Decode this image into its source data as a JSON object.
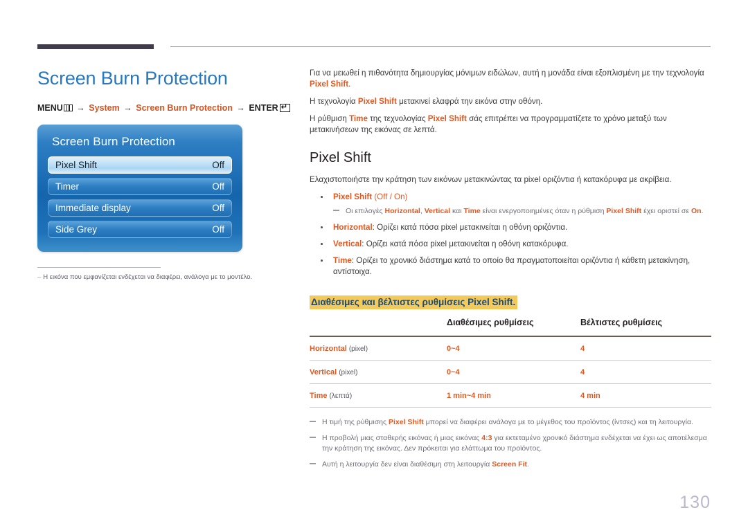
{
  "page": {
    "number": "130"
  },
  "left": {
    "title": "Screen Burn Protection",
    "breadcrumb": {
      "menu_label": "MENU",
      "menu_icon": "menu-bars-icon",
      "arrow": "→",
      "item1": "System",
      "item2": "Screen Burn Protection",
      "enter_label": "ENTER",
      "enter_icon": "enter-return-icon",
      "enter_glyph": "↵"
    },
    "osd": {
      "title": "Screen Burn Protection",
      "rows": [
        {
          "label": "Pixel Shift",
          "value": "Off",
          "selected": true
        },
        {
          "label": "Timer",
          "value": "Off",
          "selected": false
        },
        {
          "label": "Immediate display",
          "value": "Off",
          "selected": false
        },
        {
          "label": "Side Grey",
          "value": "Off",
          "selected": false
        }
      ]
    },
    "footnote": {
      "dash": "–",
      "text": "Η εικόνα που εμφανίζεται ενδέχεται να διαφέρει, ανάλογα με το μοντέλο."
    }
  },
  "right": {
    "intro": {
      "p1_a": "Για να μειωθεί η πιθανότητα δημιουργίας μόνιμων ειδώλων, αυτή η μονάδα είναι εξοπλισμένη με την τεχνολογία ",
      "p1_b": "Pixel Shift",
      "p1_c": ".",
      "p2_a": "Η τεχνολογία ",
      "p2_b": "Pixel Shift",
      "p2_c": " μετακινεί ελαφρά την εικόνα στην οθόνη.",
      "p3_a": "Η ρύθμιση ",
      "p3_b": "Time",
      "p3_c": " της τεχνολογίας ",
      "p3_d": "Pixel Shift",
      "p3_e": " σάς επιτρέπει να προγραμματίζετε το χρόνο μεταξύ των μετακινήσεων της εικόνας σε λεπτά."
    },
    "section": {
      "heading": "Pixel Shift",
      "lead": "Ελαχιστοποιήστε την κράτηση των εικόνων μετακινώντας τα pixel οριζόντια ή κατακόρυφα με ακρίβεια."
    },
    "bullets": [
      {
        "term": "Pixel Shift",
        "rest": " (Off / On)",
        "subnote": {
          "a": "Οι επιλογές ",
          "b": "Horizontal",
          "c": ", ",
          "d": "Vertical",
          "e": " και ",
          "f": "Time",
          "g": " είναι ενεργοποιημένες όταν η ρύθμιση ",
          "h": "Pixel Shift",
          "i": " έχει οριστεί σε ",
          "j": "On",
          "k": "."
        }
      },
      {
        "term": "Horizontal",
        "rest": ": Ορίζει κατά πόσα pixel μετακινείται η οθόνη οριζόντια."
      },
      {
        "term": "Vertical",
        "rest": ": Ορίζει κατά πόσα pixel μετακινείται η οθόνη κατακόρυφα."
      },
      {
        "term": "Time",
        "rest": ": Ορίζει το χρονικό διάστημα κατά το οποίο θα πραγματοποιείται οριζόντια ή κάθετη μετακίνηση, αντίστοιχα."
      }
    ],
    "highlight_heading": "Διαθέσιμες και βέλτιστες ρυθμίσεις Pixel Shift.",
    "table": {
      "headers": [
        "",
        "Διαθέσιμες ρυθμίσεις",
        "Βέλτιστες ρυθμίσεις"
      ],
      "rows": [
        {
          "label": "Horizontal",
          "unit": "(pixel)",
          "available": "0~4",
          "optimal": "4"
        },
        {
          "label": "Vertical",
          "unit": "(pixel)",
          "available": "0~4",
          "optimal": "4"
        },
        {
          "label": "Time",
          "unit": "(λεπτά)",
          "available": "1 min~4 min",
          "optimal": "4 min"
        }
      ]
    },
    "notes": [
      {
        "a": "Η τιμή της ρύθμισης ",
        "b": "Pixel Shift",
        "c": " μπορεί να διαφέρει ανάλογα με το μέγεθος του προϊόντος (ίντσες) και τη λειτουργία."
      },
      {
        "a": "Η προβολή μιας σταθερής εικόνας ή μιας εικόνας ",
        "b": "4:3",
        "c": " για εκτεταμένο χρονικό διάστημα ενδέχεται να έχει ως αποτέλεσμα την κράτηση της εικόνας. Δεν πρόκειται για ελάττωμα του προϊόντος."
      },
      {
        "a": "Αυτή η λειτουργία δεν είναι διαθέσιμη στη λειτουργία ",
        "b": "Screen Fit",
        "c": "."
      }
    ]
  }
}
